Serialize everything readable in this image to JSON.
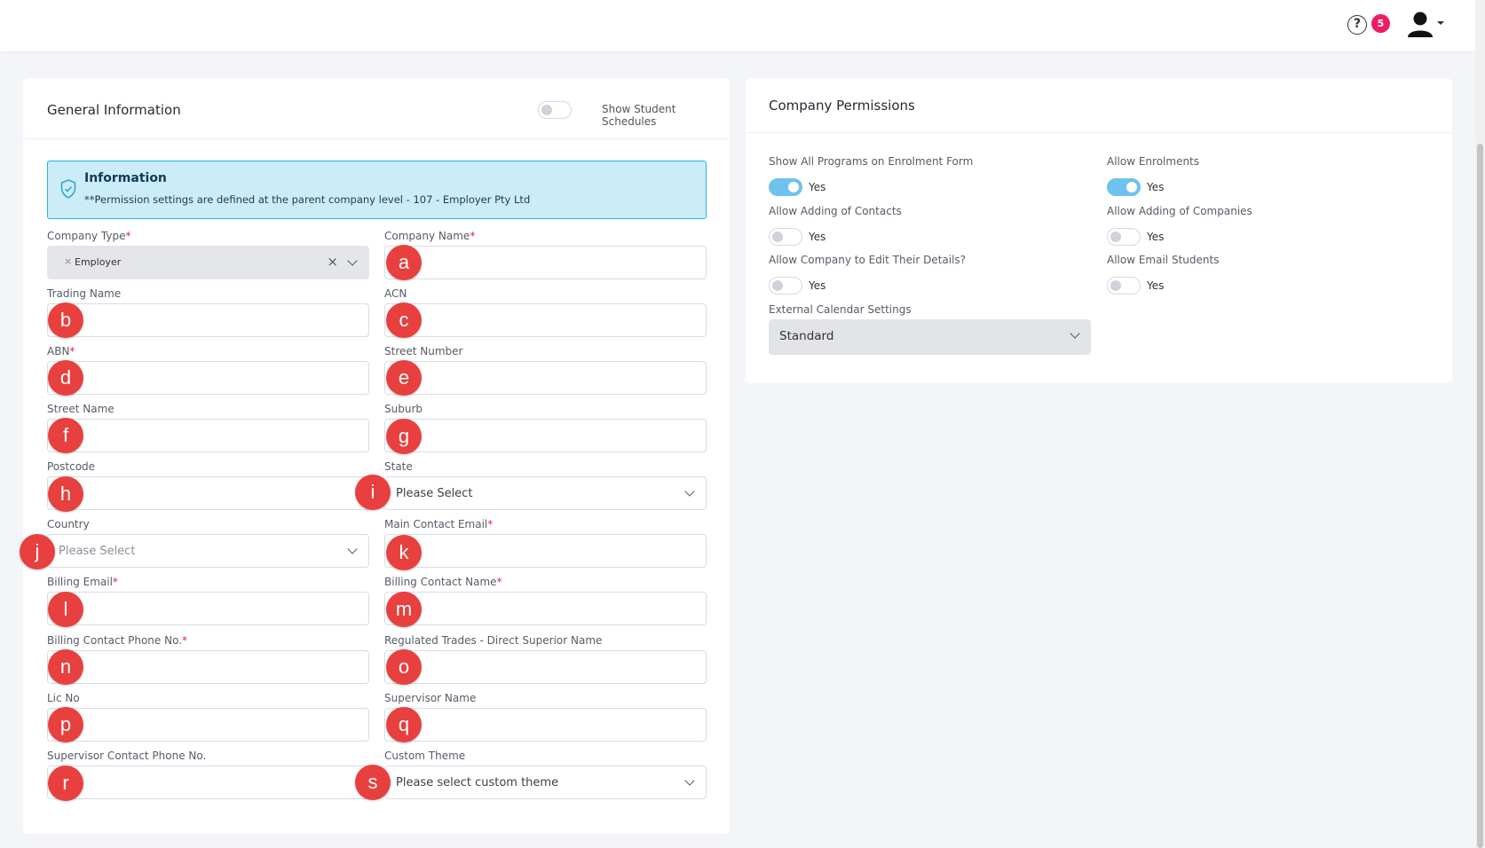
{
  "header": {
    "help_icon": "?",
    "notification_count": "5"
  },
  "general": {
    "title": "General Information",
    "show_schedules_label": "Show Student Schedules",
    "info_title": "Information",
    "info_text": "**Permission settings are defined at the parent company level - 107 - Employer Pty Ltd"
  },
  "fields": {
    "company_type": {
      "label": "Company Type",
      "required": "*",
      "tag": "Employer",
      "tag_x": "×",
      "clear": "×"
    },
    "company_name": {
      "label": "Company Name",
      "required": "*"
    },
    "trading_name": {
      "label": "Trading Name"
    },
    "acn": {
      "label": "ACN"
    },
    "abn": {
      "label": "ABN",
      "required": "*"
    },
    "street_number": {
      "label": "Street Number"
    },
    "street_name": {
      "label": "Street Name"
    },
    "suburb": {
      "label": "Suburb"
    },
    "postcode": {
      "label": "Postcode"
    },
    "state": {
      "label": "State",
      "value": "Please Select"
    },
    "country": {
      "label": "Country",
      "value": "Please Select"
    },
    "main_contact_email": {
      "label": "Main Contact Email",
      "required": "*"
    },
    "billing_email": {
      "label": "Billing Email",
      "required": "*"
    },
    "billing_contact_name": {
      "label": "Billing Contact Name",
      "required": "*"
    },
    "billing_contact_phone": {
      "label": "Billing Contact Phone No.",
      "required": "*"
    },
    "regulated_trades": {
      "label": "Regulated Trades - Direct Superior Name"
    },
    "lic_no": {
      "label": "Lic No"
    },
    "supervisor_name": {
      "label": "Supervisor Name"
    },
    "supervisor_phone": {
      "label": "Supervisor Contact Phone No."
    },
    "custom_theme": {
      "label": "Custom Theme",
      "value": "Please select custom theme"
    }
  },
  "markers": [
    "a",
    "b",
    "c",
    "d",
    "e",
    "f",
    "g",
    "h",
    "i",
    "j",
    "k",
    "l",
    "m",
    "n",
    "o",
    "p",
    "q",
    "r",
    "s"
  ],
  "permissions": {
    "title": "Company Permissions",
    "items": [
      {
        "label": "Show All Programs on Enrolment Form",
        "value": "Yes",
        "on": true
      },
      {
        "label": "Allow Enrolments",
        "value": "Yes",
        "on": true
      },
      {
        "label": "Allow Adding of Contacts",
        "value": "Yes",
        "on": false
      },
      {
        "label": "Allow Adding of Companies",
        "value": "Yes",
        "on": false
      },
      {
        "label": "Allow Company to Edit Their Details?",
        "value": "Yes",
        "on": false
      },
      {
        "label": "Allow Email Students",
        "value": "Yes",
        "on": false
      }
    ],
    "calendar_label": "External Calendar Settings",
    "calendar_value": "Standard"
  },
  "colors": {
    "accent": "#6ec3ee",
    "marker": "#e8403e",
    "badge": "#ec1c62",
    "info_bg": "#ccecf8",
    "info_border": "#27b4e6"
  }
}
